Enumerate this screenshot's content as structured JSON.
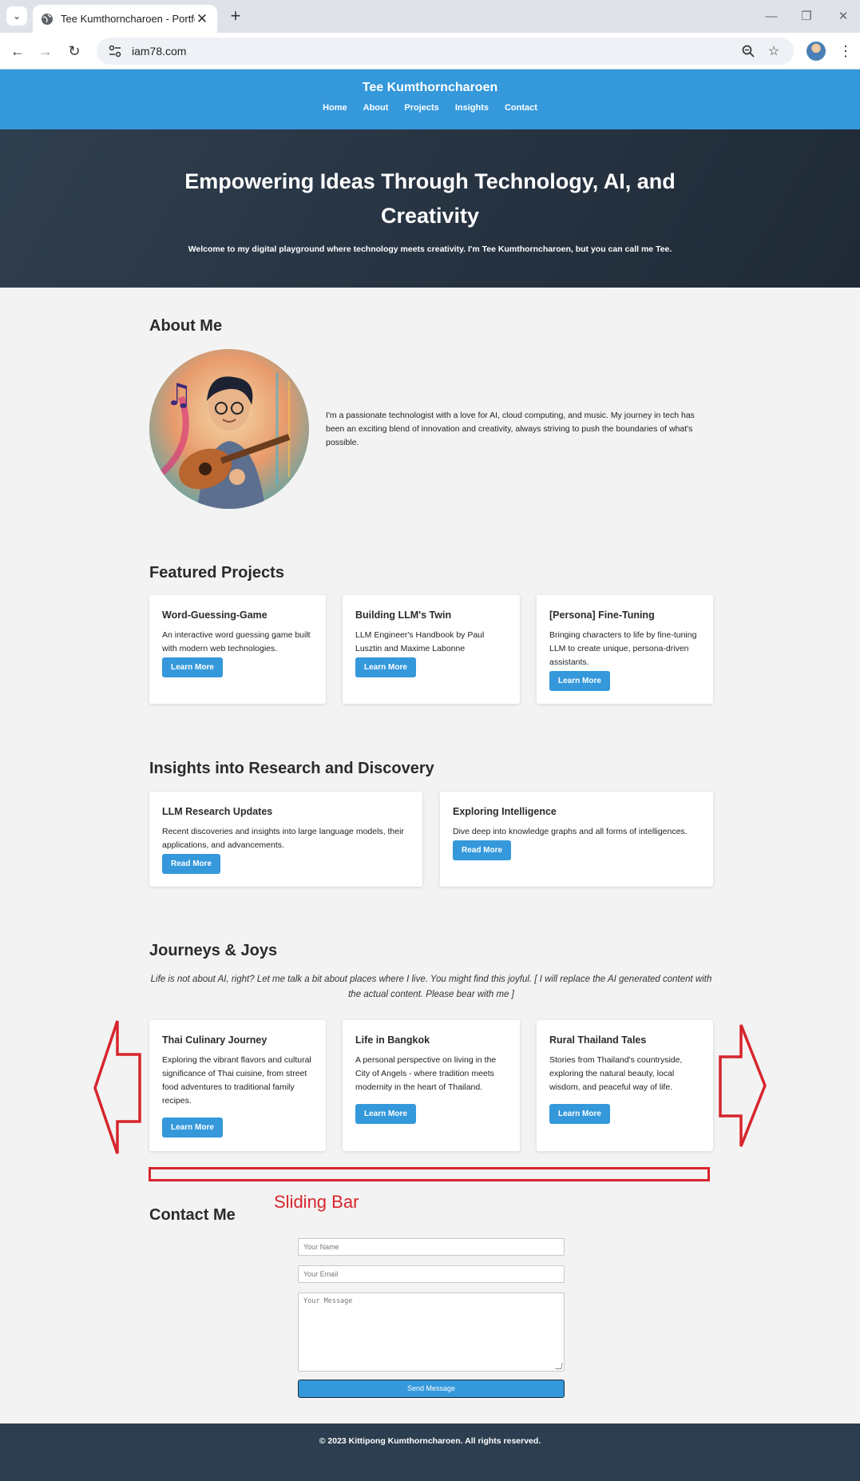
{
  "browser": {
    "tab_title": "Tee Kumthorncharoen - Portfolio",
    "url": "iam78.com",
    "icons": [
      "tab-search-icon",
      "globe-icon",
      "close-icon",
      "new-tab-icon",
      "back-icon",
      "forward-icon",
      "reload-icon",
      "site-settings-icon",
      "zoom-icon",
      "star-icon",
      "profile-avatar",
      "menu-icon",
      "minimize-icon",
      "restore-icon",
      "window-close-icon"
    ]
  },
  "header": {
    "site_name": "Tee Kumthorncharoen",
    "nav": [
      "Home",
      "About",
      "Projects",
      "Insights",
      "Contact"
    ]
  },
  "hero": {
    "title": "Empowering Ideas Through Technology, AI, and Creativity",
    "subtitle": "Welcome to my digital playground where technology meets creativity. I'm Tee Kumthorncharoen, but you can call me Tee."
  },
  "about": {
    "title": "About Me",
    "text": "I'm a passionate technologist with a love for AI, cloud computing, and music. My journey in tech has been an exciting blend of innovation and creativity, always striving to push the boundaries of what's possible."
  },
  "projects": {
    "title": "Featured Projects",
    "items": [
      {
        "title": "Word-Guessing-Game",
        "desc": "An interactive word guessing game built with modern web technologies.",
        "button": "Learn More"
      },
      {
        "title": "Building LLM's Twin",
        "desc": "LLM Engineer's Handbook by Paul Lusztin and Maxime Labonne",
        "button": "Learn More"
      },
      {
        "title": "[Persona] Fine-Tuning",
        "desc": "Bringing characters to life by fine-tuning LLM to create unique, persona-driven assistants.",
        "button": "Learn More"
      }
    ]
  },
  "insights": {
    "title": "Insights into Research and Discovery",
    "items": [
      {
        "title": "LLM Research Updates",
        "desc": "Recent discoveries and insights into large language models, their applications, and advancements.",
        "button": "Read More"
      },
      {
        "title": "Exploring Intelligence",
        "desc": "Dive deep into knowledge graphs and all forms of intelligences.",
        "button": "Read More"
      }
    ]
  },
  "journeys": {
    "title": "Journeys & Joys",
    "subtitle": "Life is not about AI, right? Let me talk a bit about places where I live. You might find this joyful. [ I will replace the AI generated content with the actual content. Please bear with me ]",
    "items": [
      {
        "title": "Thai Culinary Journey",
        "desc": "Exploring the vibrant flavors and cultural significance of Thai cuisine, from street food adventures to traditional family recipes.",
        "button": "Learn More"
      },
      {
        "title": "Life in Bangkok",
        "desc": "A personal perspective on living in the City of Angels - where tradition meets modernity in the heart of Thailand.",
        "button": "Learn More"
      },
      {
        "title": "Rural Thailand Tales",
        "desc": "Stories from Thailand's countryside, exploring the natural beauty, local wisdom, and peaceful way of life.",
        "button": "Learn More"
      }
    ]
  },
  "annotation": {
    "label": "Sliding Bar",
    "color": "#d7252c"
  },
  "contact": {
    "title": "Contact Me",
    "name_placeholder": "Your Name",
    "email_placeholder": "Your Email",
    "message_placeholder": "Your Message",
    "send_label": "Send Message"
  },
  "footer": {
    "text": "© 2023 Kittipong Kumthorncharoen. All rights reserved."
  },
  "colors": {
    "accent": "#3498db",
    "hero_bg": "#263240",
    "footer_bg": "#2c3e50",
    "annotation": "#d7252c"
  }
}
